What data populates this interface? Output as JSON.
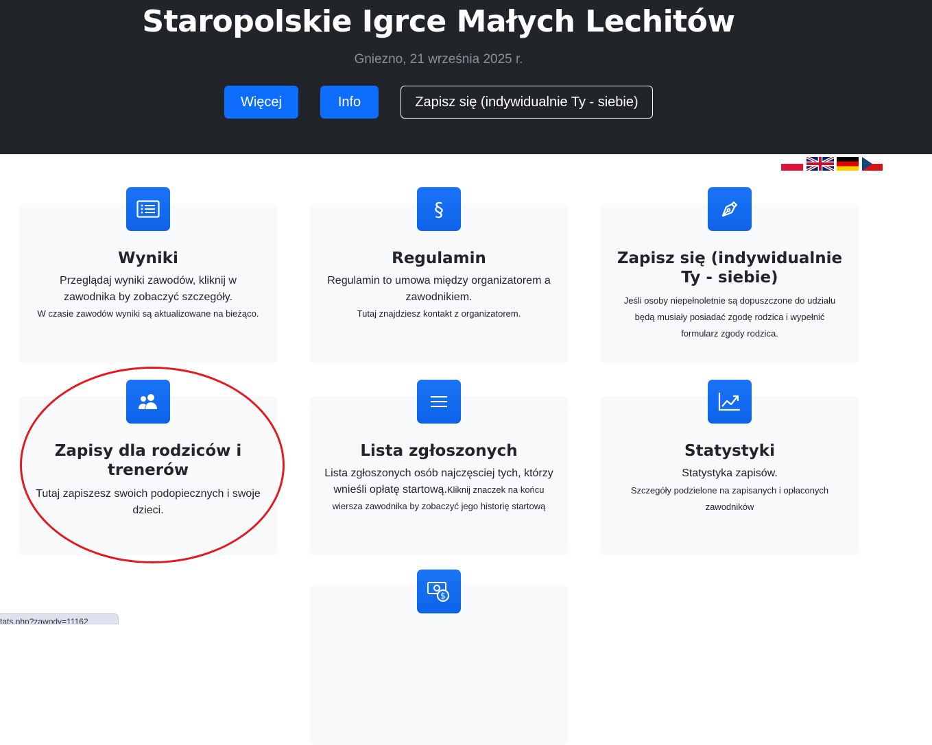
{
  "header": {
    "title": "Staropolskie Igrce Małych Lechitów",
    "subtitle": "Gniezno, 21 września 2025 r.",
    "buttons": {
      "more": "Więcej",
      "info": "Info",
      "signup": "Zapisz się (indywidualnie Ty - siebie)"
    }
  },
  "languages": [
    "pl",
    "en",
    "de",
    "cz"
  ],
  "cards": {
    "results": {
      "icon": "list-icon",
      "title": "Wyniki",
      "text": "Przeglądaj wyniki zawodów, kliknij w zawodnika by zobaczyć szczegóły.",
      "small": "W czasie zawodów wyniki są aktualizowane na bieżąco."
    },
    "rules": {
      "icon": "paragraph-icon",
      "icon_glyph": "§",
      "title": "Regulamin",
      "text": "Regulamin to umowa między organizatorem a zawodnikiem.",
      "small": "Tutaj znajdziesz kontakt z organizatorem."
    },
    "signup": {
      "icon": "pen-icon",
      "title": "Zapisz się (indywidualnie Ty - siebie)",
      "small": "Jeśli osoby niepełnoletnie są dopuszczone do udziału będą musiały posiadać zgodę rodzica i wypełnić formularz zgody rodzica."
    },
    "parents": {
      "icon": "people-icon",
      "title": "Zapisy dla rodziców i trenerów",
      "text": "Tutaj zapiszesz swoich podopiecznych i swoje dzieci."
    },
    "entries": {
      "icon": "menu-icon",
      "title": "Lista zgłoszonych",
      "text": "Lista zgłoszonych osób najczęsciej tych, którzy wnieśli opłatę startową.",
      "small": "Kliknij znaczek na końcu wiersza zawodnika by zobaczyć jego historię startową"
    },
    "stats": {
      "icon": "chart-icon",
      "title": "Statystyki",
      "text": "Statystyka zapisów.",
      "small": "Szczegóły podzielone na zapisanych i opłaconych zawodników"
    },
    "payments": {
      "icon": "cash-coin-icon"
    }
  },
  "status_bar": {
    "url": "tats.php?zawody=11162"
  },
  "colors": {
    "header_bg": "#212529",
    "primary": "#0d6efd",
    "card_bg": "#f8f9fa",
    "highlight": "#e11b22"
  }
}
